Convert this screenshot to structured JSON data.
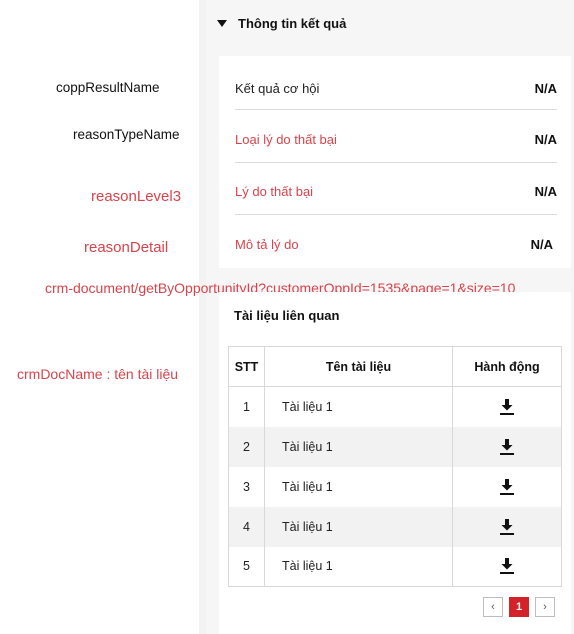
{
  "annotations": {
    "result_name": "coppResultName",
    "reason_type": "reasonTypeName",
    "reason_level": "reasonLevel3",
    "reason_detail": "reasonDetail",
    "api_endpoint": "crm-document/getByOpportunityId?customerOppId=1535&page=1&size=10",
    "doc_name": "crmDocName : tên tài liệu"
  },
  "result_section": {
    "title": "Thông tin kết quả",
    "rows": [
      {
        "label": "Kết quả cơ hội",
        "value": "N/A"
      },
      {
        "label": "Loại lý do thất bại",
        "value": "N/A"
      },
      {
        "label": "Lý do thất bại",
        "value": "N/A"
      },
      {
        "label": "Mô tả lý do",
        "value": "N/A"
      }
    ]
  },
  "docs_section": {
    "title": "Tài liệu liên quan",
    "columns": [
      "STT",
      "Tên tài liệu",
      "Hành động"
    ],
    "rows": [
      {
        "stt": "1",
        "name": "Tài liệu 1"
      },
      {
        "stt": "2",
        "name": "Tài liệu 1"
      },
      {
        "stt": "3",
        "name": "Tài liệu 1"
      },
      {
        "stt": "4",
        "name": "Tài liệu 1"
      },
      {
        "stt": "5",
        "name": "Tài liệu 1"
      }
    ]
  },
  "pagination": {
    "prev": "‹",
    "current": "1",
    "next": "›"
  },
  "colors": {
    "accent": "#d3222a",
    "annotation_red": "#d9434b"
  }
}
